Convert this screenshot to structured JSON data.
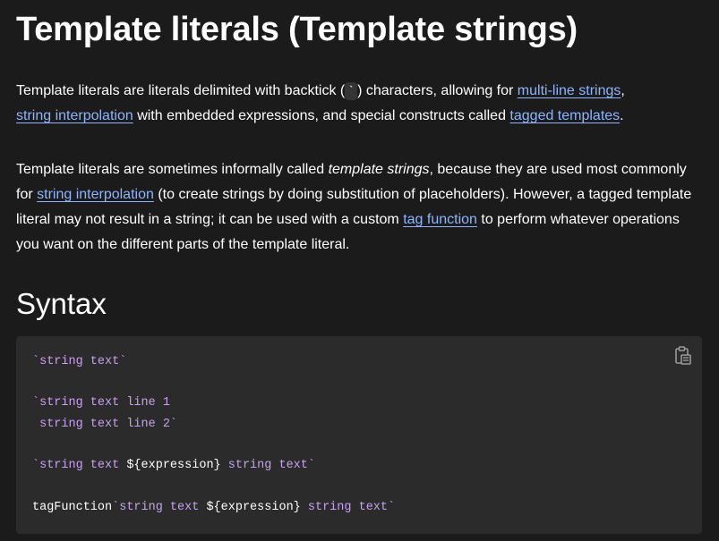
{
  "title": "Template literals (Template strings)",
  "intro": {
    "t1": "Template literals are literals delimited with backtick (",
    "backtick": "`",
    "t2": ") characters, allowing for ",
    "link_multiline": "multi-line strings",
    "t3": ", ",
    "link_interpolation": "string interpolation",
    "t4": " with embedded expressions, and special constructs called ",
    "link_tagged": "tagged templates",
    "t5": "."
  },
  "second": {
    "t1": "Template literals are sometimes informally called ",
    "em": "template strings",
    "t2": ", because they are used most commonly for ",
    "link_interpolation": "string interpolation",
    "t3": " (to create strings by doing substitution of placeholders). However, a tagged template literal may not result in a string; it can be used with a custom ",
    "link_tag_function": "tag function",
    "t4": " to perform whatever operations you want on the different parts of the template literal."
  },
  "syntax_heading": "Syntax",
  "code": {
    "copy_icon": "clipboard-copy-icon",
    "line1": "`string text`",
    "line2": "`string text line 1",
    "line3": " string text line 2`",
    "line4_a": "`string text ",
    "line4_b": "${expression}",
    "line4_c": " string text`",
    "line5_a": "tagFunction",
    "line5_b": "`string text ",
    "line5_c": "${expression}",
    "line5_d": " string text`"
  },
  "colors": {
    "background": "#1b1b1b",
    "code_background": "#2b2b2b",
    "link": "#8cb4ff",
    "code_string": "#c8a0f0"
  }
}
